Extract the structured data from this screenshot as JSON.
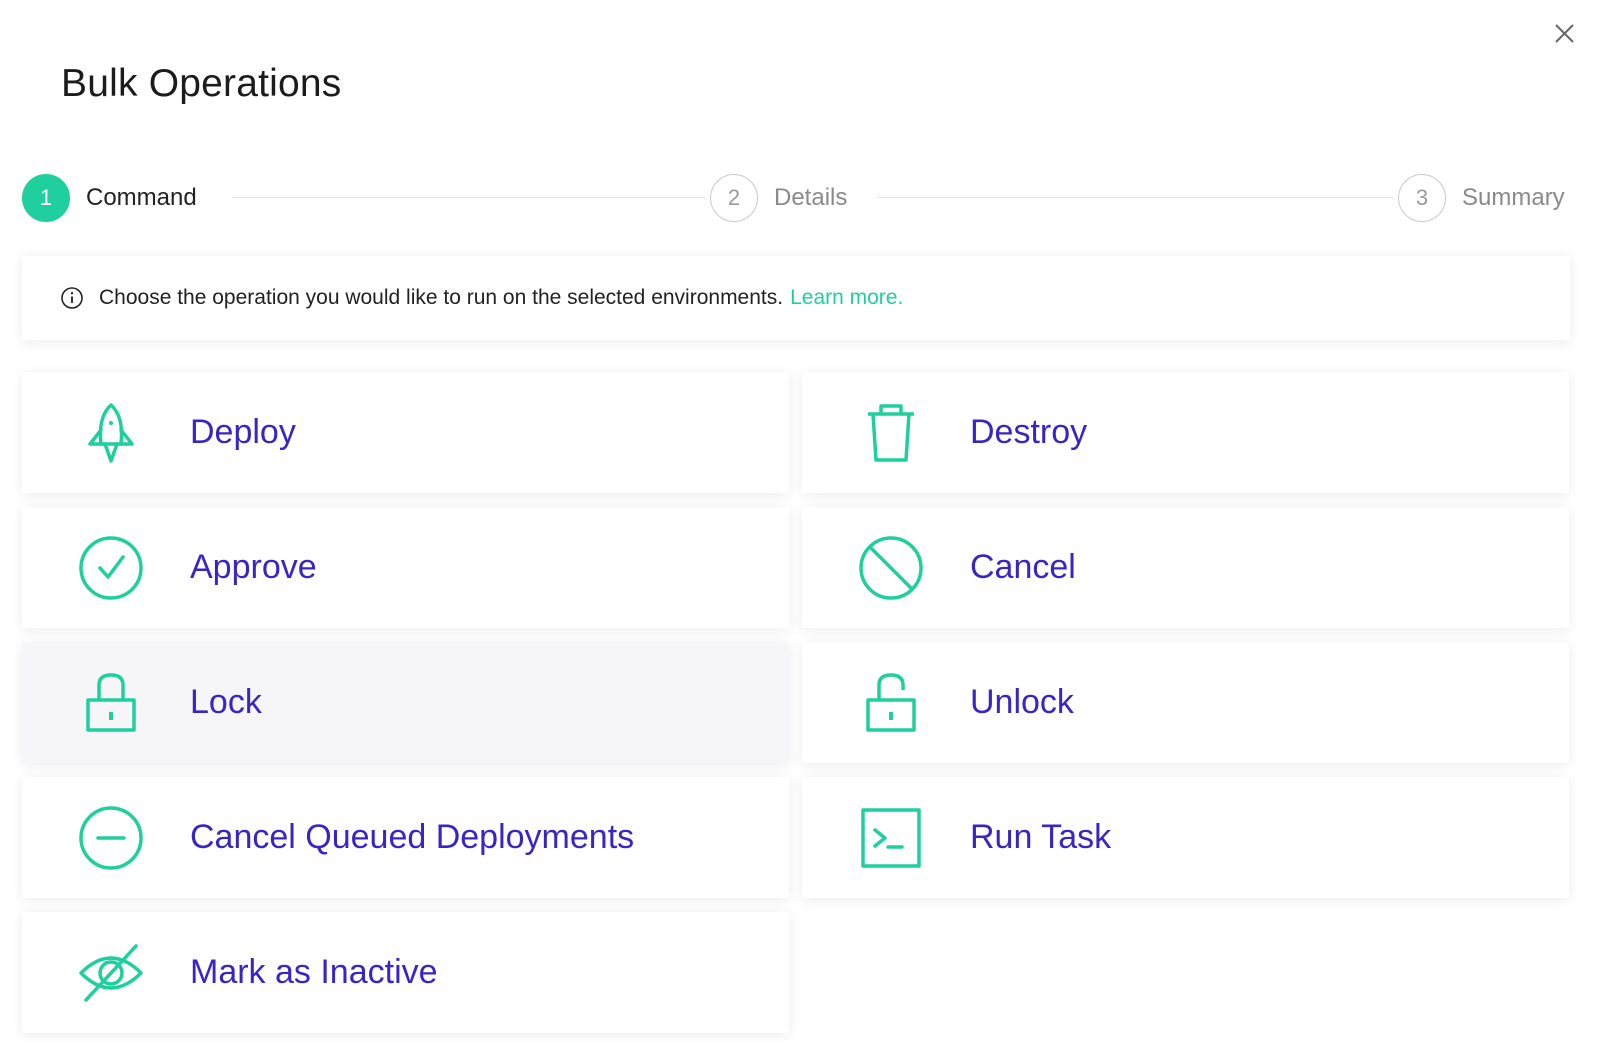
{
  "dialog": {
    "title": "Bulk Operations",
    "close_icon": "close-icon"
  },
  "steps": [
    {
      "number": "1",
      "label": "Command",
      "state": "active"
    },
    {
      "number": "2",
      "label": "Details",
      "state": "inactive"
    },
    {
      "number": "3",
      "label": "Summary",
      "state": "inactive"
    }
  ],
  "info": {
    "icon": "info-icon",
    "text": "Choose the operation you would like to run on the selected environments.",
    "link_text": "Learn more."
  },
  "operations": [
    {
      "label": "Deploy",
      "icon": "rocket-icon"
    },
    {
      "label": "Destroy",
      "icon": "trash-icon"
    },
    {
      "label": "Approve",
      "icon": "check-circle-icon"
    },
    {
      "label": "Cancel",
      "icon": "ban-icon"
    },
    {
      "label": "Lock",
      "icon": "lock-icon"
    },
    {
      "label": "Unlock",
      "icon": "unlock-icon"
    },
    {
      "label": "Cancel Queued Deployments",
      "icon": "minus-circle-icon"
    },
    {
      "label": "Run Task",
      "icon": "terminal-icon"
    },
    {
      "label": "Mark as Inactive",
      "icon": "eye-off-icon"
    }
  ],
  "colors": {
    "accent": "#1fcf9d",
    "label": "#3826c4",
    "hover_bg": "#f6f6f8"
  }
}
